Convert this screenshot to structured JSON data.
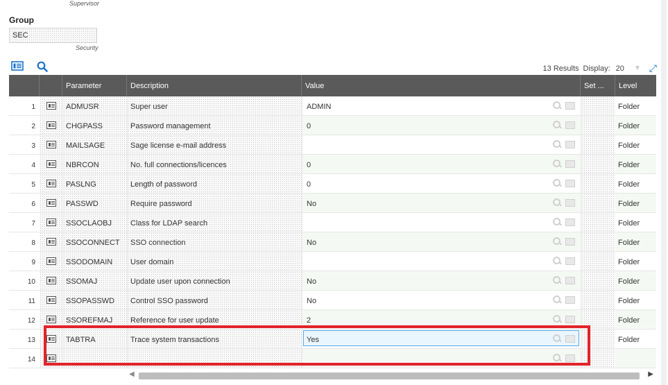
{
  "supervisor_caption": "Supervisor",
  "group": {
    "label": "Group",
    "value": "SEC",
    "caption": "Security"
  },
  "toolbar": {
    "card_icon": "card-view-icon",
    "search_icon": "search-icon"
  },
  "results": {
    "count_text": "13 Results",
    "display_label": "Display:",
    "display_value": "20"
  },
  "columns": {
    "parameter": "Parameter",
    "description": "Description",
    "value": "Value",
    "set": "Set ...",
    "level": "Level"
  },
  "rows": [
    {
      "num": "1",
      "parameter": "ADMUSR",
      "description": "Super user",
      "value": "ADMIN",
      "level": "Folder"
    },
    {
      "num": "2",
      "parameter": "CHGPASS",
      "description": "Password management",
      "value": "0",
      "level": "Folder"
    },
    {
      "num": "3",
      "parameter": "MAILSAGE",
      "description": "Sage license e-mail address",
      "value": "",
      "level": "Folder"
    },
    {
      "num": "4",
      "parameter": "NBRCON",
      "description": "No. full connections/licences",
      "value": "0",
      "level": "Folder"
    },
    {
      "num": "5",
      "parameter": "PASLNG",
      "description": "Length of password",
      "value": "0",
      "level": "Folder"
    },
    {
      "num": "6",
      "parameter": "PASSWD",
      "description": "Require password",
      "value": "No",
      "level": "Folder"
    },
    {
      "num": "7",
      "parameter": "SSOCLAOBJ",
      "description": "Class for LDAP search",
      "value": "",
      "level": "Folder"
    },
    {
      "num": "8",
      "parameter": "SSOCONNECT",
      "description": "SSO connection",
      "value": "No",
      "level": "Folder"
    },
    {
      "num": "9",
      "parameter": "SSODOMAIN",
      "description": "User domain",
      "value": "",
      "level": "Folder"
    },
    {
      "num": "10",
      "parameter": "SSOMAJ",
      "description": "Update user upon connection",
      "value": "No",
      "level": "Folder"
    },
    {
      "num": "11",
      "parameter": "SSOPASSWD",
      "description": "Control SSO password",
      "value": "No",
      "level": "Folder"
    },
    {
      "num": "12",
      "parameter": "SSOREFMAJ",
      "description": "Reference for user update",
      "value": "2",
      "level": "Folder"
    },
    {
      "num": "13",
      "parameter": "TABTRA",
      "description": "Trace system transactions",
      "value": "Yes",
      "level": "Folder",
      "selected": true
    },
    {
      "num": "14",
      "parameter": "",
      "description": "",
      "value": "",
      "level": ""
    }
  ],
  "highlight_color": "#e2232a"
}
